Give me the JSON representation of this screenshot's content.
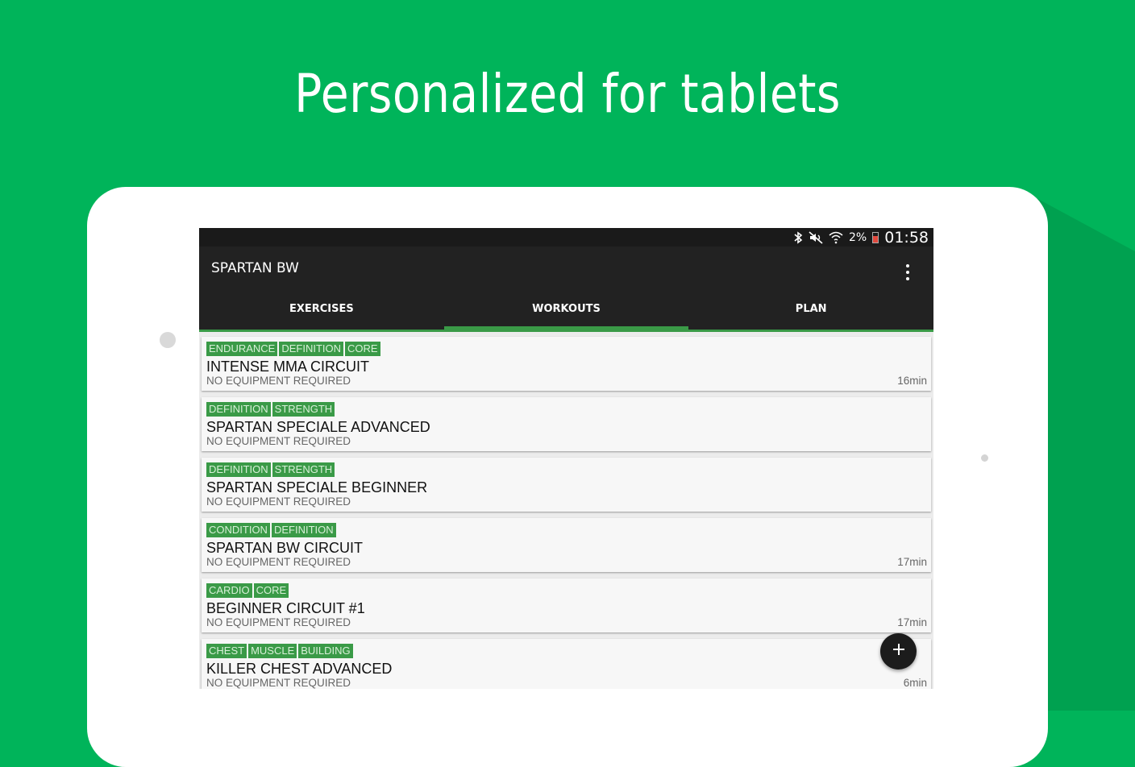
{
  "headline": "Personalized for tablets",
  "status_bar": {
    "battery_percent": "2%",
    "time": "01:58",
    "icons": [
      "bluetooth-icon",
      "mute-icon",
      "wifi-icon",
      "battery-icon"
    ]
  },
  "app": {
    "title": "SPARTAN BW",
    "menu_icon": "overflow-menu-icon"
  },
  "tabs": [
    {
      "label": "EXERCISES",
      "active": false
    },
    {
      "label": "WORKOUTS",
      "active": true
    },
    {
      "label": "PLAN",
      "active": false
    }
  ],
  "workouts": [
    {
      "tags": [
        "ENDURANCE",
        "DEFINITION",
        "CORE"
      ],
      "title": "INTENSE MMA CIRCUIT",
      "subtitle": "NO EQUIPMENT REQUIRED",
      "duration": "16min"
    },
    {
      "tags": [
        "DEFINITION",
        "STRENGTH"
      ],
      "title": "SPARTAN SPECIALE ADVANCED",
      "subtitle": "NO EQUIPMENT REQUIRED",
      "duration": ""
    },
    {
      "tags": [
        "DEFINITION",
        "STRENGTH"
      ],
      "title": "SPARTAN SPECIALE BEGINNER",
      "subtitle": "NO EQUIPMENT REQUIRED",
      "duration": ""
    },
    {
      "tags": [
        "CONDITION",
        "DEFINITION"
      ],
      "title": "SPARTAN BW CIRCUIT",
      "subtitle": "NO EQUIPMENT REQUIRED",
      "duration": "17min"
    },
    {
      "tags": [
        "CARDIO",
        "CORE"
      ],
      "title": "BEGINNER CIRCUIT #1",
      "subtitle": "NO EQUIPMENT REQUIRED",
      "duration": "17min"
    },
    {
      "tags": [
        "CHEST",
        "MUSCLE",
        "BUILDING"
      ],
      "title": "KILLER CHEST ADVANCED",
      "subtitle": "NO EQUIPMENT REQUIRED",
      "duration": "6min"
    }
  ],
  "fab_icon": "plus-icon",
  "colors": {
    "background": "#00b45a",
    "appbar": "#222222",
    "accent": "#3a9a47",
    "tag_text": "#d8f0d8"
  }
}
